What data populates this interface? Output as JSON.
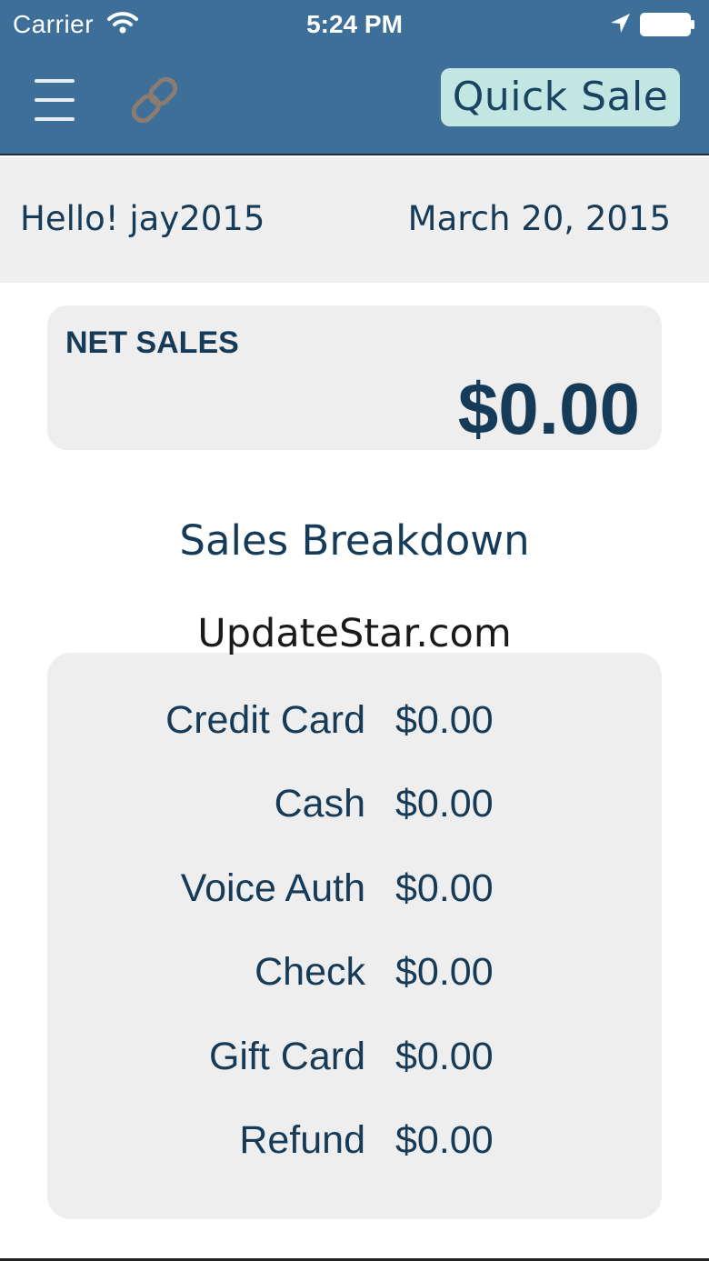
{
  "status_bar": {
    "carrier": "Carrier",
    "time": "5:24 PM",
    "icons": [
      "wifi-icon",
      "location-arrow-icon",
      "battery-icon"
    ]
  },
  "header": {
    "menu_icon": "hamburger-menu-icon",
    "link_icon": "link-chain-icon",
    "quick_sale_label": "Quick Sale"
  },
  "greeting": {
    "hello": "Hello! jay2015",
    "date": "March 20, 2015"
  },
  "net_sales": {
    "label": "NET SALES",
    "value": "$0.00"
  },
  "breakdown": {
    "title": "Sales Breakdown",
    "rows": [
      {
        "label": "Credit Card",
        "value": "$0.00"
      },
      {
        "label": "Cash",
        "value": "$0.00"
      },
      {
        "label": "Voice Auth",
        "value": "$0.00"
      },
      {
        "label": "Check",
        "value": "$0.00"
      },
      {
        "label": "Gift Card",
        "value": "$0.00"
      },
      {
        "label": "Refund",
        "value": "$0.00"
      }
    ]
  },
  "watermark": "UpdateStar.com",
  "colors": {
    "header_bg": "#3d6f98",
    "accent_button": "#c2e6e1",
    "text_primary": "#163b58",
    "card_bg": "#eeeeee"
  }
}
